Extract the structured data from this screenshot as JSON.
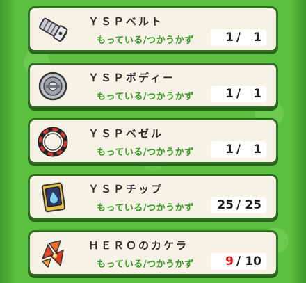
{
  "items": [
    {
      "name": "ＹＳＰベルト",
      "label": "もっている/つかうかず",
      "have": "1",
      "separator": "/",
      "need": "1",
      "icon": "belt-icon",
      "low": false
    },
    {
      "name": "ＹＳＰボディー",
      "label": "もっている/つかうかず",
      "have": "1",
      "separator": "/",
      "need": "1",
      "icon": "body-disc-icon",
      "low": false
    },
    {
      "name": "ＹＳＰベゼル",
      "label": "もっている/つかうかず",
      "have": "1",
      "separator": "/",
      "need": "1",
      "icon": "bezel-ring-icon",
      "low": false
    },
    {
      "name": "ＹＳＰチップ",
      "label": "もっている/つかうかず",
      "have": "25",
      "separator": "/",
      "need": "25",
      "icon": "chip-card-icon",
      "low": false
    },
    {
      "name": "ＨＥＲＯのカケラ",
      "label": "もっている/つかうかず",
      "have": "9",
      "separator": "/",
      "need": "10",
      "icon": "hero-fragment-icon",
      "low": true
    }
  ],
  "colors": {
    "background": "#5bbf3f",
    "card": "#f6f3e6",
    "border": "#2f6e21",
    "label": "#3a9a2a",
    "low_count": "#e01010"
  }
}
